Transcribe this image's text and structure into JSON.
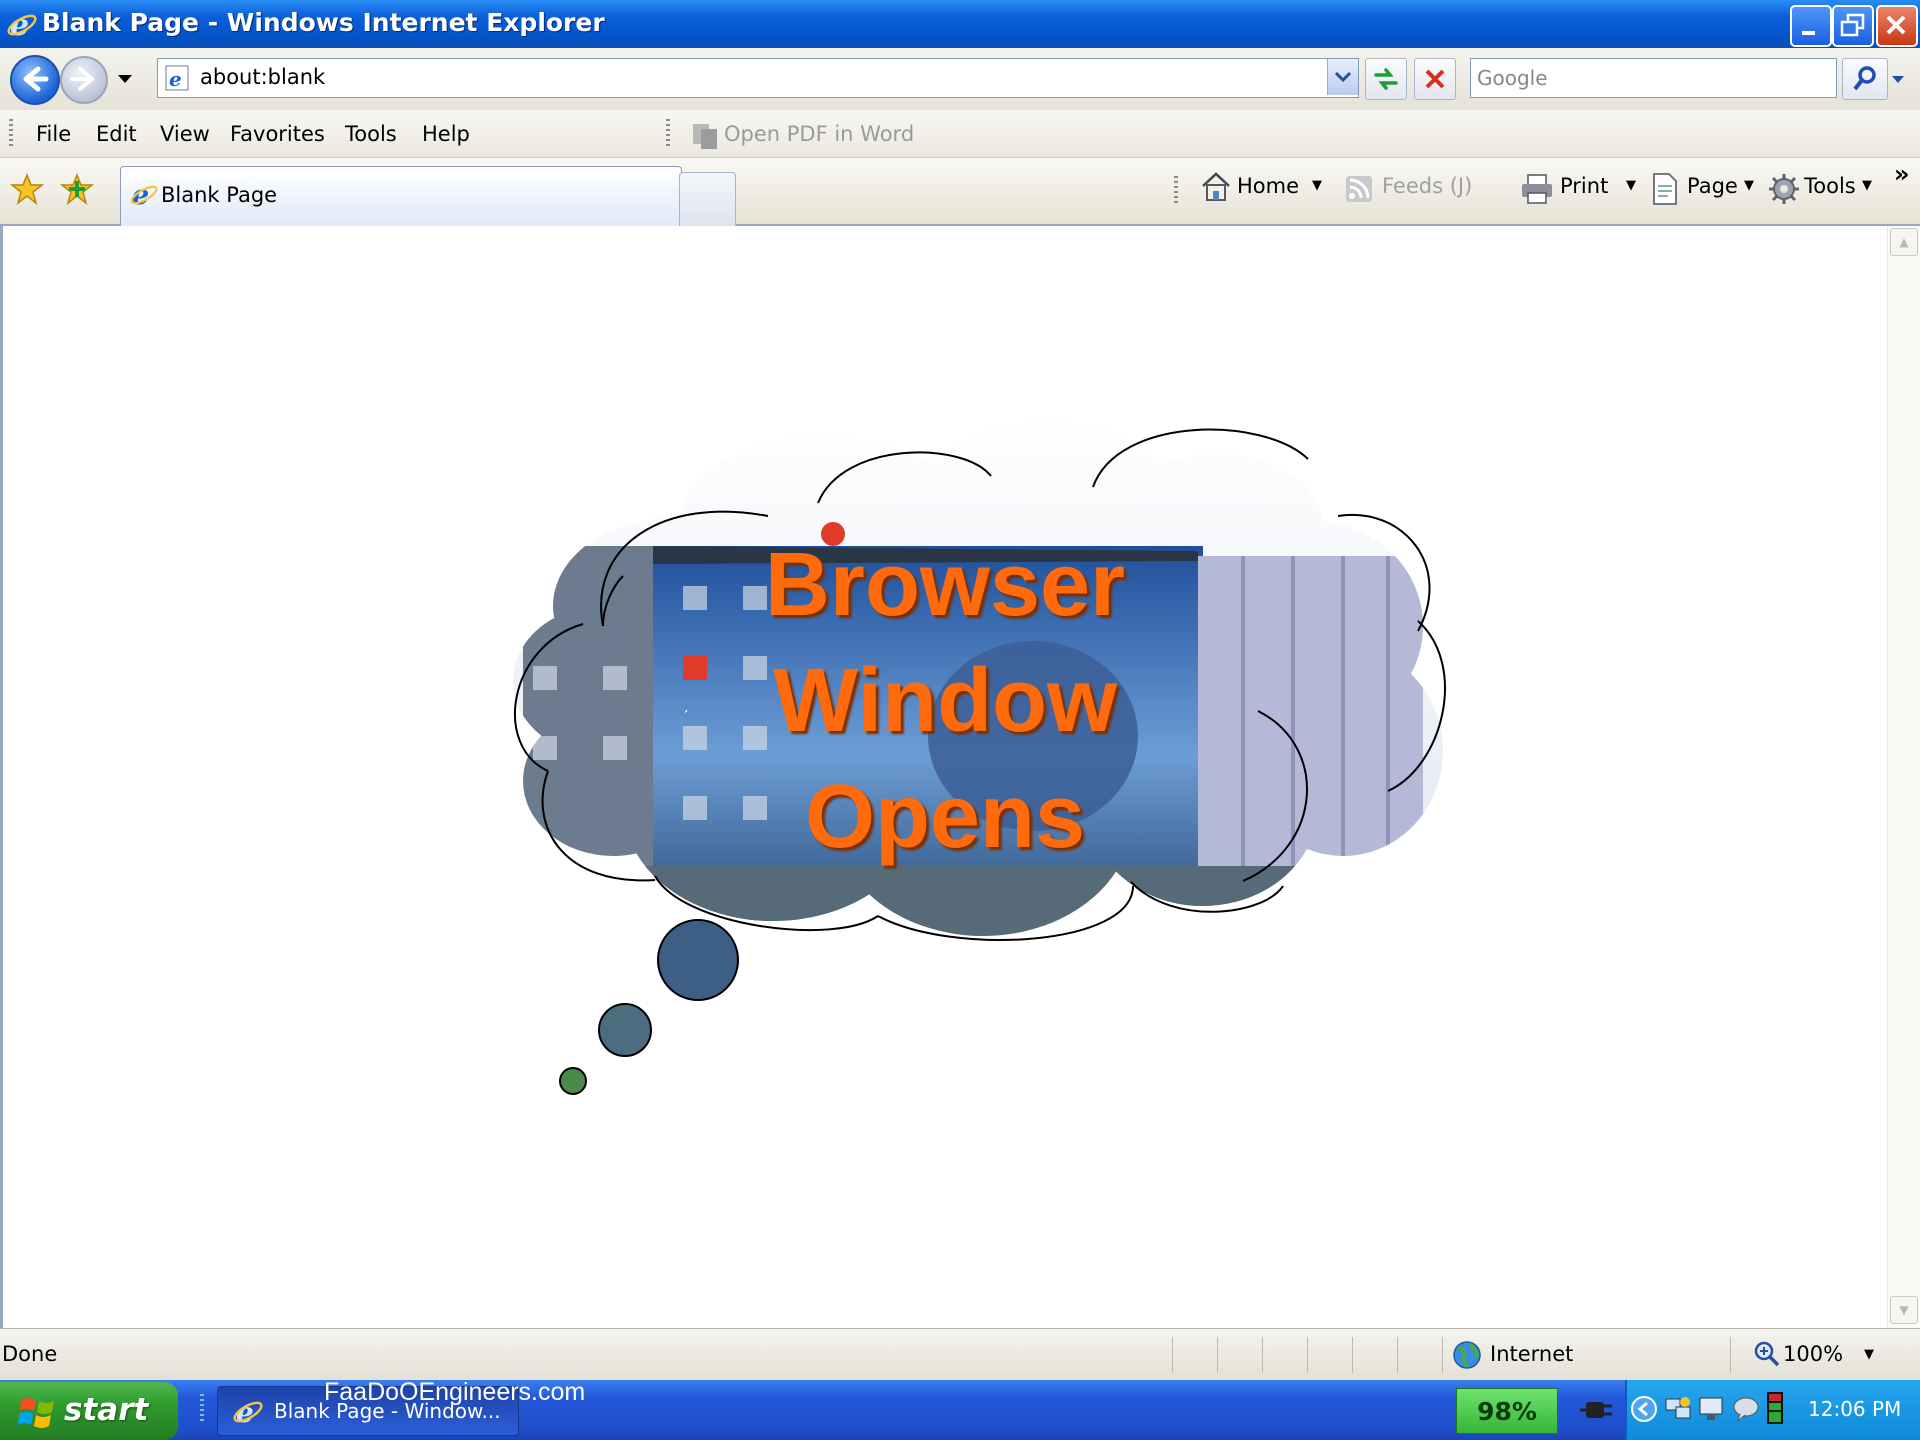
{
  "window": {
    "title": "Blank Page - Windows Internet Explorer",
    "minimize_glyph": "_",
    "maximize_glyph": "□",
    "close_glyph": "×"
  },
  "address_bar": {
    "url": "about:blank",
    "search_placeholder": "Google"
  },
  "menu": {
    "items": [
      "File",
      "Edit",
      "View",
      "Favorites",
      "Tools",
      "Help"
    ],
    "open_pdf_in_word": "Open PDF in Word"
  },
  "tabs": {
    "active_label": "Blank Page"
  },
  "command_bar": {
    "home": "Home",
    "feeds": "Feeds (J)",
    "print": "Print",
    "page": "Page",
    "tools": "Tools",
    "more": "»"
  },
  "content": {
    "cloud_lines": [
      "Browser",
      "Window",
      "Opens"
    ],
    "text_color": "#ff6a0d"
  },
  "status_bar": {
    "status": "Done",
    "zone": "Internet",
    "zoom": "100%"
  },
  "taskbar": {
    "start_label": "start",
    "task_item": "Blank Page - Window...",
    "watermark": "FaaDoOEngineers.com",
    "battery": "98%",
    "clock": "12:06 PM"
  },
  "colors": {
    "titlebar": "#0553c8",
    "taskbar": "#2458d8",
    "start_button": "#2e9b2e",
    "accent_orange": "#ff6a0d"
  },
  "icons": [
    "ie-logo-icon",
    "back-arrow-icon",
    "forward-arrow-icon",
    "refresh-icon",
    "stop-icon",
    "search-icon",
    "favorites-star-icon",
    "add-favorites-icon",
    "home-icon",
    "feeds-icon",
    "print-icon",
    "page-icon",
    "tools-gear-icon",
    "globe-icon",
    "zoom-icon",
    "windows-logo-icon"
  ]
}
